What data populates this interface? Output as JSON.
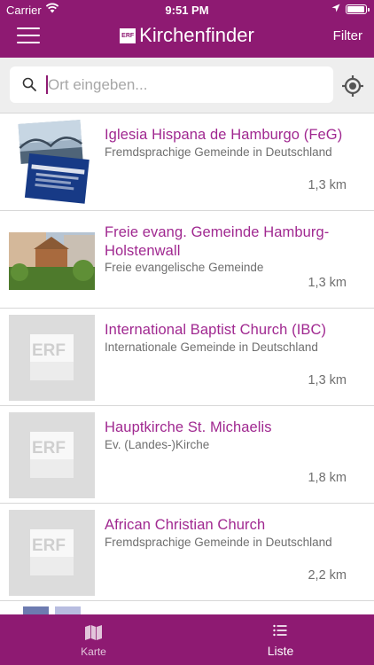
{
  "status_bar": {
    "carrier": "Carrier",
    "time": "9:51 PM"
  },
  "header": {
    "logo_text": "ERF",
    "title": "Kirchenfinder",
    "filter_label": "Filter",
    "menu_icon": "hamburger-menu-icon"
  },
  "search": {
    "value": "",
    "placeholder": "Ort eingeben...",
    "search_icon": "search-icon",
    "locate_icon": "location-target-icon"
  },
  "churches": [
    {
      "title": "Iglesia Hispana de Hamburgo (FeG)",
      "subtitle": "Fremdsprachige Gemeinde in Deutschland",
      "distance": "1,3 km",
      "image": "church-photo-flyer"
    },
    {
      "title": "Freie evang. Gemeinde Hamburg-Holstenwall",
      "subtitle": "Freie evangelische Gemeinde",
      "distance": "1,3 km",
      "image": "church-photo-building"
    },
    {
      "title": "International Baptist Church (IBC)",
      "subtitle": "Internationale Gemeinde in Deutschland",
      "distance": "1,3 km",
      "image": "placeholder-erf-logo",
      "placeholder_logo": "ERF"
    },
    {
      "title": "Hauptkirche St. Michaelis",
      "subtitle": "Ev. (Landes-)Kirche",
      "distance": "1,8 km",
      "image": "placeholder-erf-logo",
      "placeholder_logo": "ERF"
    },
    {
      "title": "African Christian Church",
      "subtitle": "Fremdsprachige Gemeinde in Deutschland",
      "distance": "2,2 km",
      "image": "placeholder-erf-logo",
      "placeholder_logo": "ERF"
    }
  ],
  "tabs": {
    "karte": {
      "label": "Karte",
      "icon": "map-icon"
    },
    "liste": {
      "label": "Liste",
      "icon": "list-icon",
      "selected": true
    }
  },
  "colors": {
    "brand": "#8e1a72",
    "title_text": "#a02890",
    "secondary_text": "#6f6f6f",
    "placeholder_bg": "#dcdcdc"
  }
}
